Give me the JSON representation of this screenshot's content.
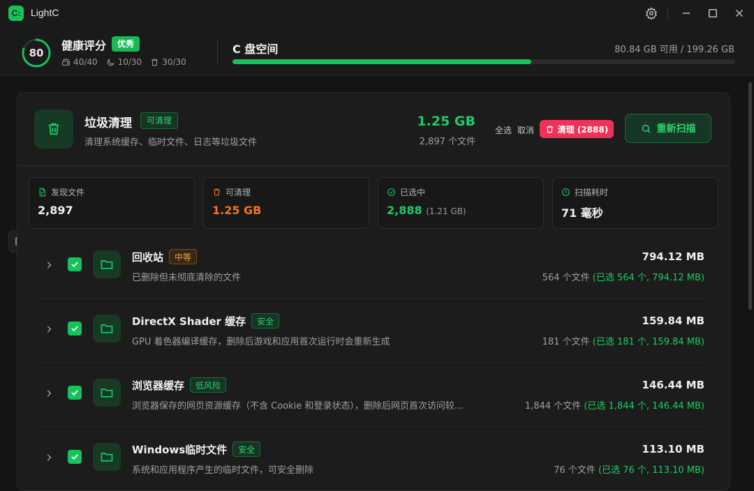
{
  "app": {
    "logo_text": "C:",
    "title": "LightC"
  },
  "health": {
    "score": "80",
    "score_fraction": 0.8,
    "title": "健康评分",
    "badge": "优秀",
    "stats": [
      {
        "icon": "drive-icon",
        "text": "40/40"
      },
      {
        "icon": "moon-icon",
        "text": "10/30"
      },
      {
        "icon": "trash-icon",
        "text": "30/30"
      }
    ]
  },
  "disk": {
    "title": "C 盘空间",
    "usage": "80.84 GB 可用 / 199.26 GB",
    "used_fraction": 0.594
  },
  "junk": {
    "title": "垃圾清理",
    "badge": "可清理",
    "description": "清理系统缓存、临时文件、日志等垃圾文件",
    "size": "1.25 GB",
    "count": "2,897 个文件",
    "select_all": "全选",
    "cancel": "取消",
    "clean_button": "清理 (2888)",
    "rescan_button": "重新扫描"
  },
  "stats": [
    {
      "icon": "file-icon",
      "label": "发现文件",
      "value": "2,897",
      "sub": "",
      "color": "#f0f0f0"
    },
    {
      "icon": "trash-icon",
      "label": "可清理",
      "value": "1.25 GB",
      "sub": "",
      "color": "#f97316"
    },
    {
      "icon": "check-circle-icon",
      "label": "已选中",
      "value": "2,888",
      "sub": "(1.21 GB)",
      "color": "#1ecb66"
    },
    {
      "icon": "clock-icon",
      "label": "扫描耗时",
      "value": "71 毫秒",
      "sub": "",
      "color": "#f0f0f0"
    }
  ],
  "items": [
    {
      "name": "回收站",
      "tag": "中等",
      "tag_type": "medium",
      "checked": true,
      "description": "已删除但未彻底清除的文件",
      "size": "794.12 MB",
      "count": "564 个文件 ",
      "selected": "(已选 564 个, 794.12 MB)"
    },
    {
      "name": "DirectX Shader 缓存",
      "tag": "安全",
      "tag_type": "safe",
      "checked": true,
      "description": "GPU 着色器编译缓存，删除后游戏和应用首次运行时会重新生成",
      "size": "159.84 MB",
      "count": "181 个文件 ",
      "selected": "(已选 181 个, 159.84 MB)"
    },
    {
      "name": "浏览器缓存",
      "tag": "低风险",
      "tag_type": "low",
      "checked": true,
      "description": "浏览器保存的网页资源缓存（不含 Cookie 和登录状态），删除后网页首次访问较...",
      "size": "146.44 MB",
      "count": "1,844 个文件 ",
      "selected": "(已选 1,844 个, 146.44 MB)"
    },
    {
      "name": "Windows临时文件",
      "tag": "安全",
      "tag_type": "safe",
      "checked": true,
      "description": "系统和应用程序产生的临时文件，可安全删除",
      "size": "113.10 MB",
      "count": "76 个文件 ",
      "selected": "(已选 76 个, 113.10 MB)"
    }
  ]
}
